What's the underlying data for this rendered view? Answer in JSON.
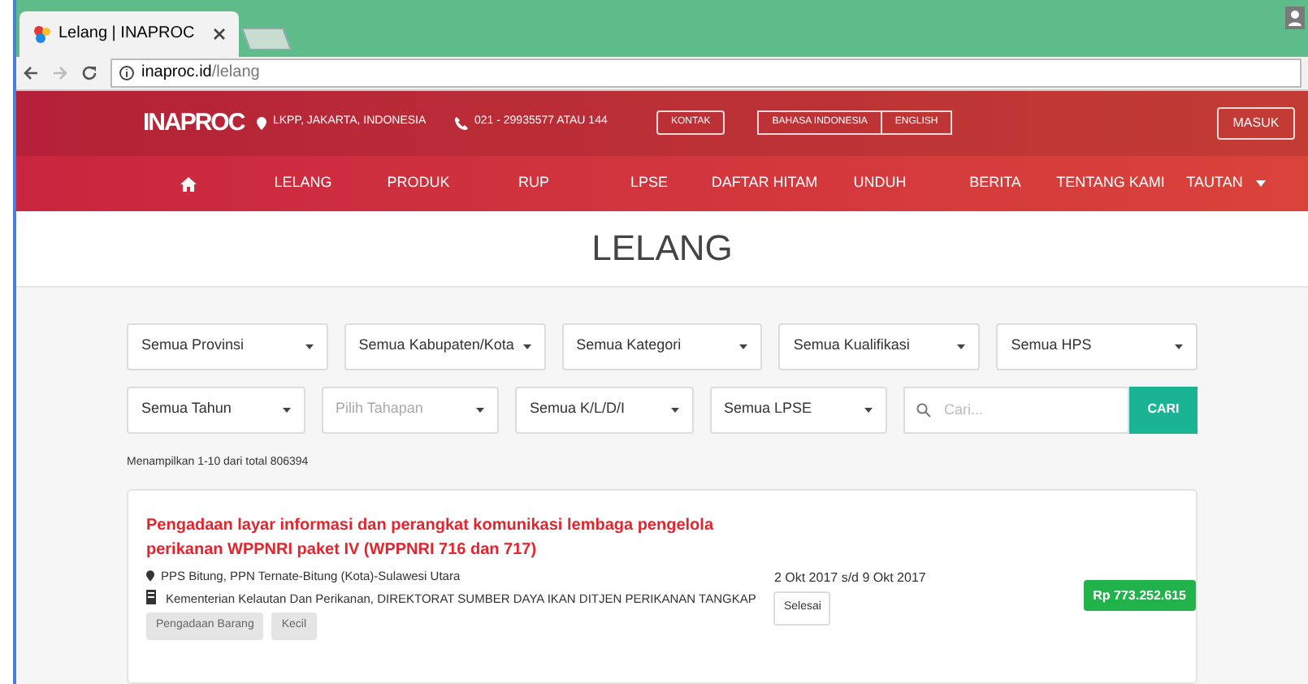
{
  "browser": {
    "tab_title": "Lelang | INAPROC",
    "url_host": "inaproc.id",
    "url_path": "/lelang"
  },
  "header": {
    "logo": "INAPROC",
    "location": "LKPP, JAKARTA, INDONESIA",
    "phone": "021 - 29935577 ATAU 144",
    "contact_button": "KONTAK",
    "languages": [
      {
        "label": "BAHASA INDONESIA",
        "selected": false
      },
      {
        "label": "ENGLISH",
        "selected": false
      }
    ],
    "login_button": "MASUK"
  },
  "nav": [
    {
      "kind": "home"
    },
    {
      "kind": "link",
      "label": "LELANG"
    },
    {
      "kind": "link",
      "label": "PRODUK"
    },
    {
      "kind": "link",
      "label": "RUP"
    },
    {
      "kind": "link",
      "label": "LPSE"
    },
    {
      "kind": "link",
      "label": "DAFTAR HITAM"
    },
    {
      "kind": "link",
      "label": "UNDUH"
    },
    {
      "kind": "link",
      "label": "BERITA"
    },
    {
      "kind": "link",
      "label": "TENTANG KAMI"
    },
    {
      "kind": "dropdown",
      "label": "TAUTAN"
    }
  ],
  "page_title": "LELANG",
  "filters_row_1": [
    {
      "value": "Semua Provinsi"
    },
    {
      "value": "Semua Kabupaten/Kota"
    },
    {
      "value": "Semua Kategori"
    },
    {
      "value": "Semua Kualifikasi"
    },
    {
      "value": "Semua HPS"
    }
  ],
  "filters_row_2": [
    {
      "value": "Semua Tahun"
    },
    {
      "placeholder": "Pilih Tahapan"
    },
    {
      "value": "Semua K/L/D/I"
    },
    {
      "value": "Semua LPSE"
    }
  ],
  "search": {
    "placeholder": "Cari...",
    "button": "CARI"
  },
  "result_count": "Menampilkan 1-10 dari total 806394",
  "results": [
    {
      "title": "Pengadaan layar informasi dan perangkat komunikasi lembaga pengelola perikanan WPPNRI paket IV (WPPNRI 716 dan 717)",
      "location": "PPS Bitung, PPN Ternate-Bitung (Kota)-Sulawesi Utara",
      "agency": "Kementerian Kelautan Dan Perikanan, DIREKTORAT SUMBER DAYA IKAN DITJEN PERIKANAN TANGKAP",
      "tags": [
        "Pengadaan Barang",
        "Kecil"
      ],
      "dates": "2 Okt 2017 s/d 9 Okt 2017",
      "status": "Selesai",
      "price": "Rp 773.252.615"
    }
  ]
}
